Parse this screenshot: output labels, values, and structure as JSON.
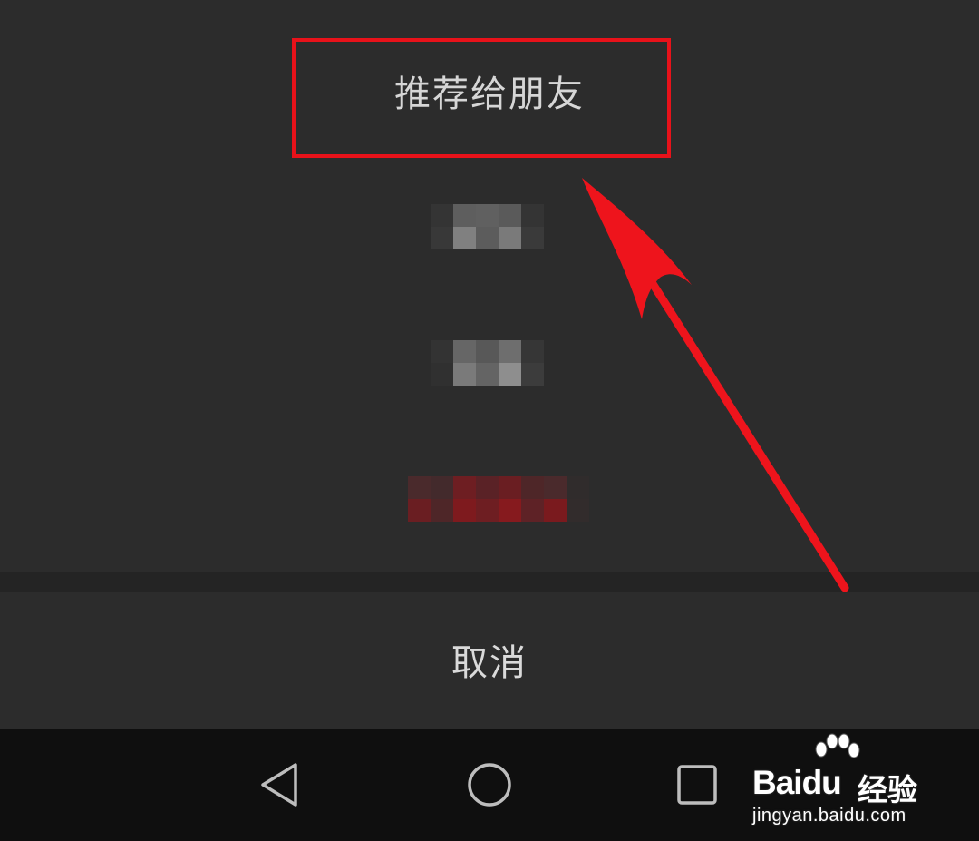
{
  "menu": {
    "recommend_label": "推荐给朋友",
    "cancel_label": "取消"
  },
  "redacted_items": [
    {
      "id": "item-2",
      "tone": "gray"
    },
    {
      "id": "item-3",
      "tone": "gray"
    },
    {
      "id": "item-4",
      "tone": "red"
    }
  ],
  "annotation": {
    "highlight_color": "#e8121a",
    "arrow_color": "#ee141c"
  },
  "navbar": {
    "back": "back-icon",
    "home": "home-icon",
    "recent": "recent-apps-icon"
  },
  "watermark": {
    "brand_prefix": "Bai",
    "brand_suffix": "du",
    "brand_cn": "经验",
    "url": "jingyan.baidu.com"
  }
}
